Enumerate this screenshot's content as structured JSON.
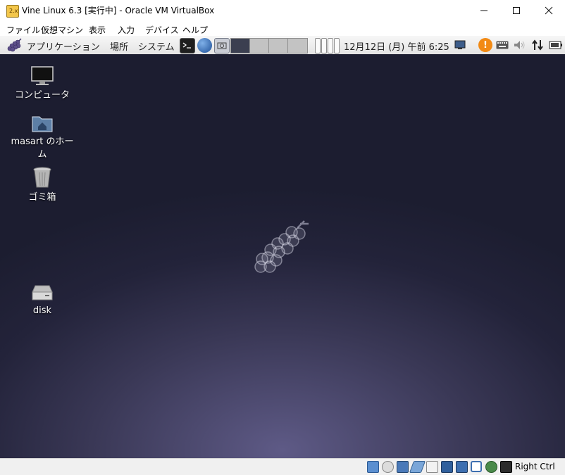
{
  "window": {
    "title": "Vine Linux 6.3 [実行中] - Oracle VM VirtualBox",
    "app_icon_text": "2.x",
    "controls": {
      "minimize": "—",
      "maximize": "☐",
      "close": "✕"
    }
  },
  "menubar": {
    "items": [
      "ファイル",
      "仮想マシン",
      "表示",
      "入力",
      "デバイス",
      "ヘルプ"
    ]
  },
  "panel": {
    "menus": [
      "アプリケーション",
      "場所",
      "システム"
    ],
    "launchers": [
      "terminal-icon",
      "web-browser-icon",
      "screenshot-icon"
    ],
    "clock": "12月12日 (月) 午前 6:25",
    "tray": [
      "display-icon",
      "update-alert-icon",
      "keyboard-icon",
      "volume-icon",
      "network-icon",
      "battery-icon"
    ]
  },
  "desktop": {
    "icons": [
      {
        "label": "コンピュータ",
        "icon": "computer-icon"
      },
      {
        "label": "masart のホーム",
        "icon": "home-folder-icon"
      },
      {
        "label": "ゴミ箱",
        "icon": "trash-icon"
      },
      {
        "label": "disk",
        "icon": "disk-icon"
      }
    ],
    "colors": {
      "bg_dark": "#1c1d30",
      "bg_glow": "#5e5a86"
    }
  },
  "statusbar": {
    "icons": [
      "hard-disk-icon",
      "optical-drive-icon",
      "audio-icon",
      "usb-icon",
      "shared-folders-icon",
      "display-status-icon",
      "network-status-icon",
      "recording-icon",
      "cpu-icon",
      "mouse-integration-icon",
      "keyboard-capture-icon"
    ],
    "host_key": "Right Ctrl"
  }
}
